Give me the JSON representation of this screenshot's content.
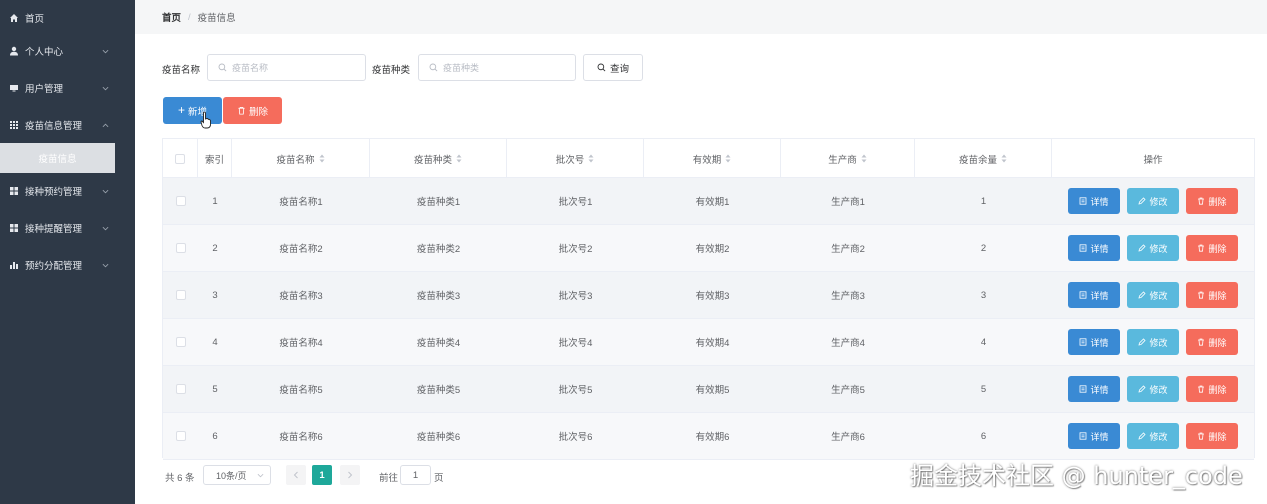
{
  "sidebar": {
    "items": [
      {
        "label": "首页",
        "icon": "home-icon",
        "arrow": false
      },
      {
        "label": "个人中心",
        "icon": "user-icon",
        "arrow": true
      },
      {
        "label": "用户管理",
        "icon": "monitor-icon",
        "arrow": true
      },
      {
        "label": "疫苗信息管理",
        "icon": "grid-icon",
        "arrow": true
      },
      {
        "label": "接种预约管理",
        "icon": "apps-icon",
        "arrow": true
      },
      {
        "label": "接种提醒管理",
        "icon": "apps-icon",
        "arrow": true
      },
      {
        "label": "预约分配管理",
        "icon": "bar-chart-icon",
        "arrow": true
      }
    ],
    "active_sub": "疫苗信息"
  },
  "breadcrumb": {
    "home": "首页",
    "sep": "/",
    "current": "疫苗信息"
  },
  "search": {
    "name_label": "疫苗名称",
    "name_placeholder": "疫苗名称",
    "type_label": "疫苗种类",
    "type_placeholder": "疫苗种类",
    "query_label": "查询"
  },
  "actions": {
    "add_label": "新增",
    "delete_label": "删除"
  },
  "table": {
    "columns": [
      "索引",
      "疫苗名称",
      "疫苗种类",
      "批次号",
      "有效期",
      "生产商",
      "疫苗余量",
      "操作"
    ],
    "rows": [
      {
        "index": "1",
        "name": "疫苗名称1",
        "type": "疫苗种类1",
        "batch": "批次号1",
        "expiry": "有效期1",
        "maker": "生产商1",
        "stock": "1"
      },
      {
        "index": "2",
        "name": "疫苗名称2",
        "type": "疫苗种类2",
        "batch": "批次号2",
        "expiry": "有效期2",
        "maker": "生产商2",
        "stock": "2"
      },
      {
        "index": "3",
        "name": "疫苗名称3",
        "type": "疫苗种类3",
        "batch": "批次号3",
        "expiry": "有效期3",
        "maker": "生产商3",
        "stock": "3"
      },
      {
        "index": "4",
        "name": "疫苗名称4",
        "type": "疫苗种类4",
        "batch": "批次号4",
        "expiry": "有效期4",
        "maker": "生产商4",
        "stock": "4"
      },
      {
        "index": "5",
        "name": "疫苗名称5",
        "type": "疫苗种类5",
        "batch": "批次号5",
        "expiry": "有效期5",
        "maker": "生产商5",
        "stock": "5"
      },
      {
        "index": "6",
        "name": "疫苗名称6",
        "type": "疫苗种类6",
        "batch": "批次号6",
        "expiry": "有效期6",
        "maker": "生产商6",
        "stock": "6"
      }
    ],
    "op_labels": {
      "detail": "详情",
      "edit": "修改",
      "delete": "删除"
    }
  },
  "pagination": {
    "total": "共 6 条",
    "page_size": "10条/页",
    "current_page": "1",
    "goto_label": "前往",
    "goto_value": "1",
    "goto_suffix": "页"
  },
  "watermark": "掘金技术社区 @ hunter_code",
  "colors": {
    "sidebar_bg": "#2e3947",
    "primary": "#3a8ad4",
    "danger": "#f56c5c",
    "info": "#5ab9dd",
    "page_active": "#1ea89a"
  }
}
